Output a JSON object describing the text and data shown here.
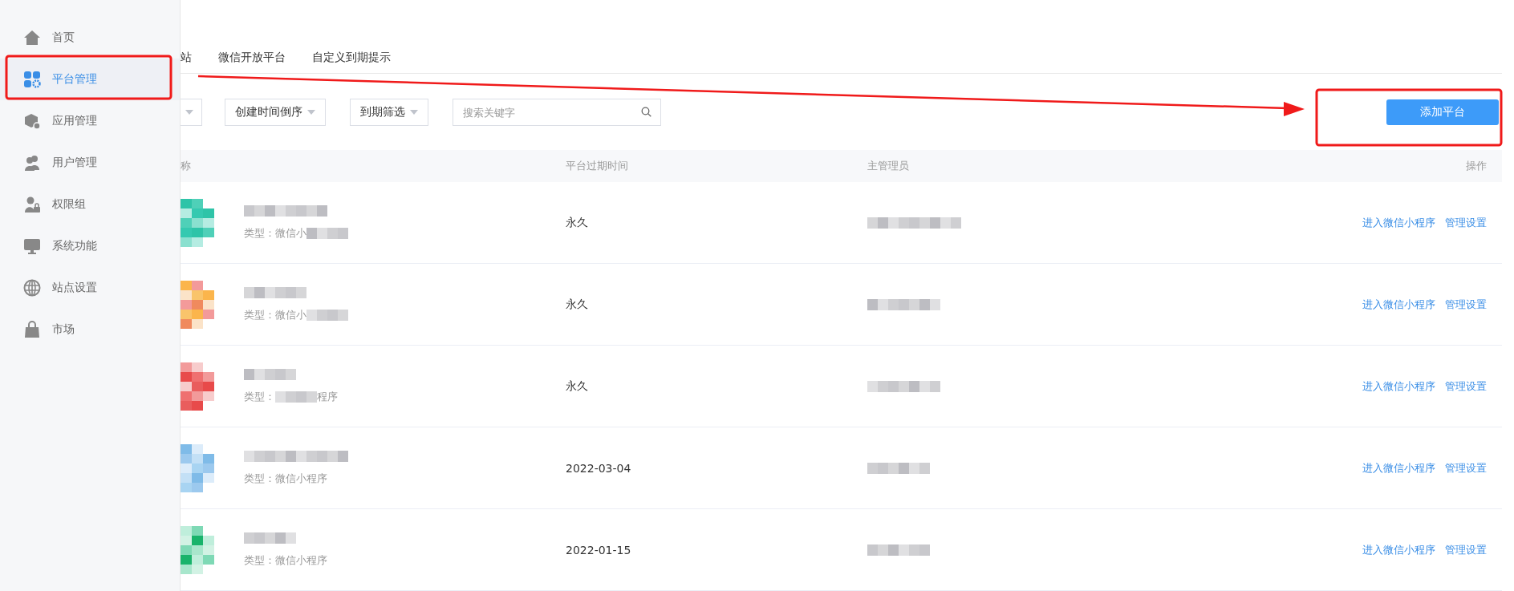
{
  "sidebar": {
    "items": [
      {
        "label": "首页",
        "selected": false
      },
      {
        "label": "平台管理",
        "selected": true
      },
      {
        "label": "应用管理",
        "selected": false
      },
      {
        "label": "用户管理",
        "selected": false
      },
      {
        "label": "权限组",
        "selected": false
      },
      {
        "label": "系统功能",
        "selected": false
      },
      {
        "label": "站点设置",
        "selected": false
      },
      {
        "label": "市场",
        "selected": false
      }
    ]
  },
  "tabs": [
    {
      "label": "站"
    },
    {
      "label": "微信开放平台"
    },
    {
      "label": "自定义到期提示"
    }
  ],
  "filters": [
    {
      "kind": "dropdown"
    },
    {
      "kind": "dropdown",
      "label": "创建时间倒序"
    },
    {
      "kind": "dropdown",
      "label": "到期筛选"
    },
    {
      "kind": "search",
      "placeholder": "搜索关键字"
    }
  ],
  "add_button": "添加平台",
  "table": {
    "columns": [
      "称",
      "平台过期时间",
      "主管理员",
      "操作"
    ],
    "rows": [
      {
        "type_parts": [
          "类型：微信小"
        ],
        "type_trailing_blur": true,
        "expiry": "永久",
        "actions": [
          "进入微信小程序",
          "管理设置"
        ]
      },
      {
        "type_parts": [
          "类型：微信小"
        ],
        "type_trailing_blur": true,
        "expiry": "永久",
        "actions": [
          "进入微信小程序",
          "管理设置"
        ]
      },
      {
        "type_parts": [
          "类型：",
          "程序"
        ],
        "type_trailing_blur": false,
        "expiry": "永久",
        "actions": [
          "进入微信小程序",
          "管理设置"
        ]
      },
      {
        "type_parts": [
          "类型：微信小程序"
        ],
        "type_trailing_blur": false,
        "expiry": "2022-03-04",
        "actions": [
          "进入微信小程序",
          "管理设置"
        ]
      },
      {
        "type_parts": [
          "类型：微信小程序"
        ],
        "type_trailing_blur": false,
        "expiry": "2022-01-15",
        "actions": [
          "进入微信小程序",
          "管理设置"
        ]
      }
    ]
  }
}
